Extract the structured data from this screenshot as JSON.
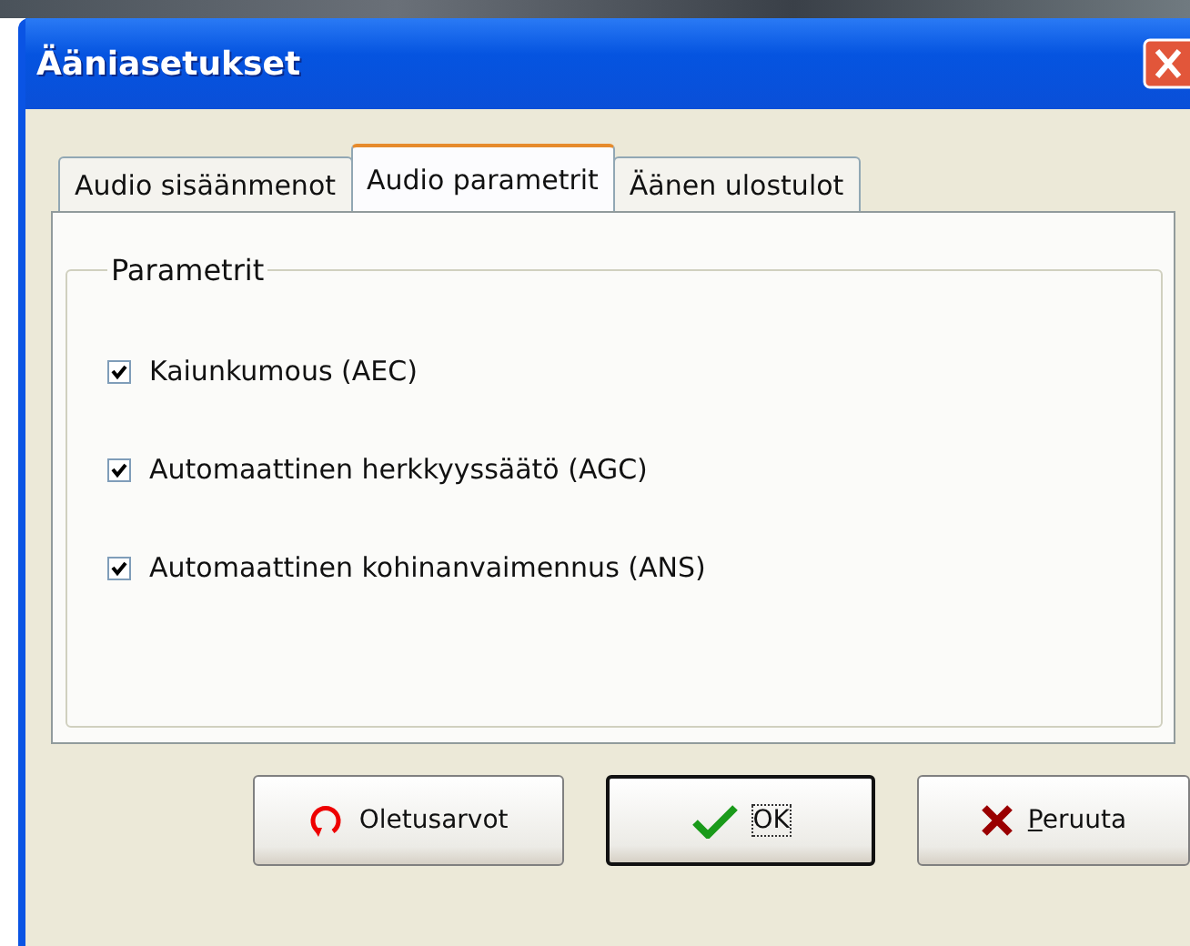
{
  "window": {
    "title": "Ääniasetukset"
  },
  "tabs": [
    {
      "label": "Audio sisäänmenot",
      "selected": false
    },
    {
      "label": "Audio parametrit",
      "selected": true
    },
    {
      "label": "Äänen ulostulot",
      "selected": false
    }
  ],
  "group": {
    "title": "Parametrit",
    "options": [
      {
        "label": "Kaiunkumous (AEC)",
        "checked": true
      },
      {
        "label": "Automaattinen herkkyyssäätö (AGC)",
        "checked": true
      },
      {
        "label": "Automaattinen kohinanvaimennus (ANS)",
        "checked": true
      }
    ]
  },
  "buttons": [
    {
      "label": "Oletusarvot",
      "kind": "reset",
      "default": false,
      "underline_first": false
    },
    {
      "label": "OK",
      "kind": "ok",
      "default": true,
      "underline_first": false
    },
    {
      "label": "Peruuta",
      "kind": "cancel",
      "default": false,
      "underline_first": true
    }
  ]
}
